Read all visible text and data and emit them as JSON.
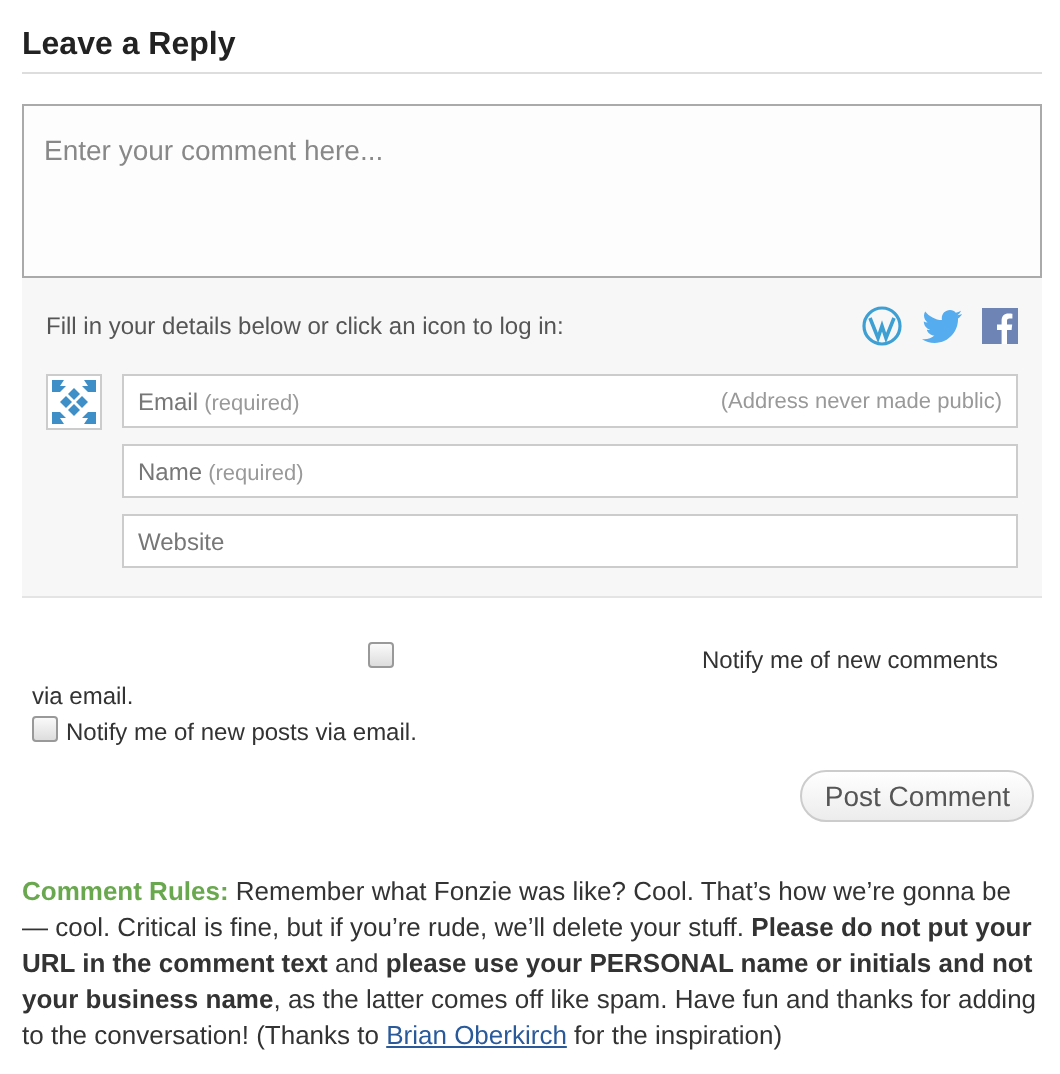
{
  "heading": "Leave a Reply",
  "comment": {
    "placeholder": "Enter your comment here..."
  },
  "login": {
    "prompt": "Fill in your details below or click an icon to log in:"
  },
  "fields": [
    {
      "label": "Email",
      "hint": "(required)",
      "note": "(Address never made public)"
    },
    {
      "label": "Name",
      "hint": "(required)"
    },
    {
      "label": "Website"
    }
  ],
  "subscriptions": [
    {
      "label": "Notify me of new comments via email.",
      "checked": false
    },
    {
      "label": "Notify me of new posts via email.",
      "checked": false
    }
  ],
  "submit": "Post Comment",
  "rules": {
    "label": "Comment Rules:",
    "before_link": "Remember what Fonzie was like? Cool. That’s how we’re gonna be — cool. Critical is fine, but if you’re rude, we’ll delete your stuff. **Please do not put your URL in the comment text** and **please use your PERSONAL name or initials and not your business name**, as the latter comes off like spam. Have fun and thanks for adding to the conversation! (Thanks to",
    "link": "Brian Oberkirch",
    "after_link": "for the inspiration)"
  }
}
